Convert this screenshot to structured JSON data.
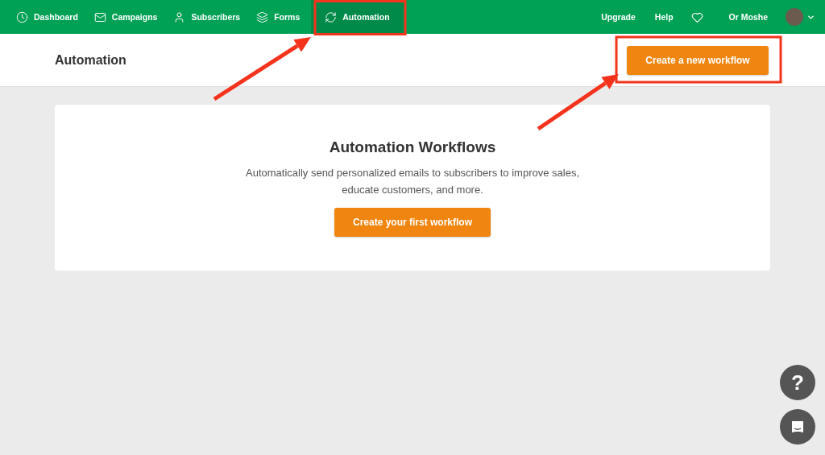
{
  "nav": {
    "items": [
      {
        "label": "Dashboard",
        "kind": "clock",
        "selected": false
      },
      {
        "label": "Campaigns",
        "kind": "mail",
        "selected": false
      },
      {
        "label": "Subscribers",
        "kind": "user",
        "selected": false
      },
      {
        "label": "Forms",
        "kind": "layers",
        "selected": false
      },
      {
        "label": "Automation",
        "kind": "refresh",
        "selected": true
      }
    ],
    "right": [
      "Upgrade",
      "Help"
    ],
    "user": "Or Moshe"
  },
  "header": {
    "title": "Automation",
    "button": "Create a new workflow"
  },
  "card": {
    "title": "Automation Workflows",
    "text": "Automatically send personalized emails to subscribers to improve sales, educate customers, and more.",
    "button": "Create your first workflow"
  },
  "help_button": "?"
}
